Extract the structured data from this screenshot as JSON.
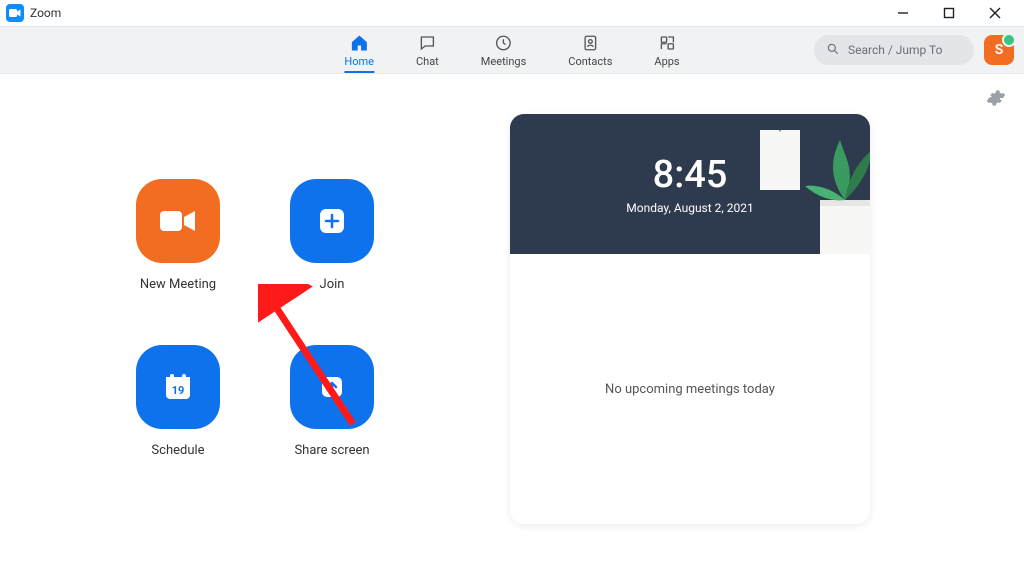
{
  "window": {
    "title": "Zoom"
  },
  "nav": {
    "home": "Home",
    "chat": "Chat",
    "meetings": "Meetings",
    "contacts": "Contacts",
    "apps": "Apps"
  },
  "search": {
    "placeholder": "Search / Jump To"
  },
  "avatar": {
    "initial": "S"
  },
  "actions": {
    "new_meeting": "New Meeting",
    "join": "Join",
    "schedule": "Schedule",
    "share_screen": "Share screen",
    "schedule_day": "19"
  },
  "clock": {
    "time": "8:45",
    "date": "Monday, August 2, 2021"
  },
  "upcoming": {
    "empty": "No upcoming meetings today"
  }
}
